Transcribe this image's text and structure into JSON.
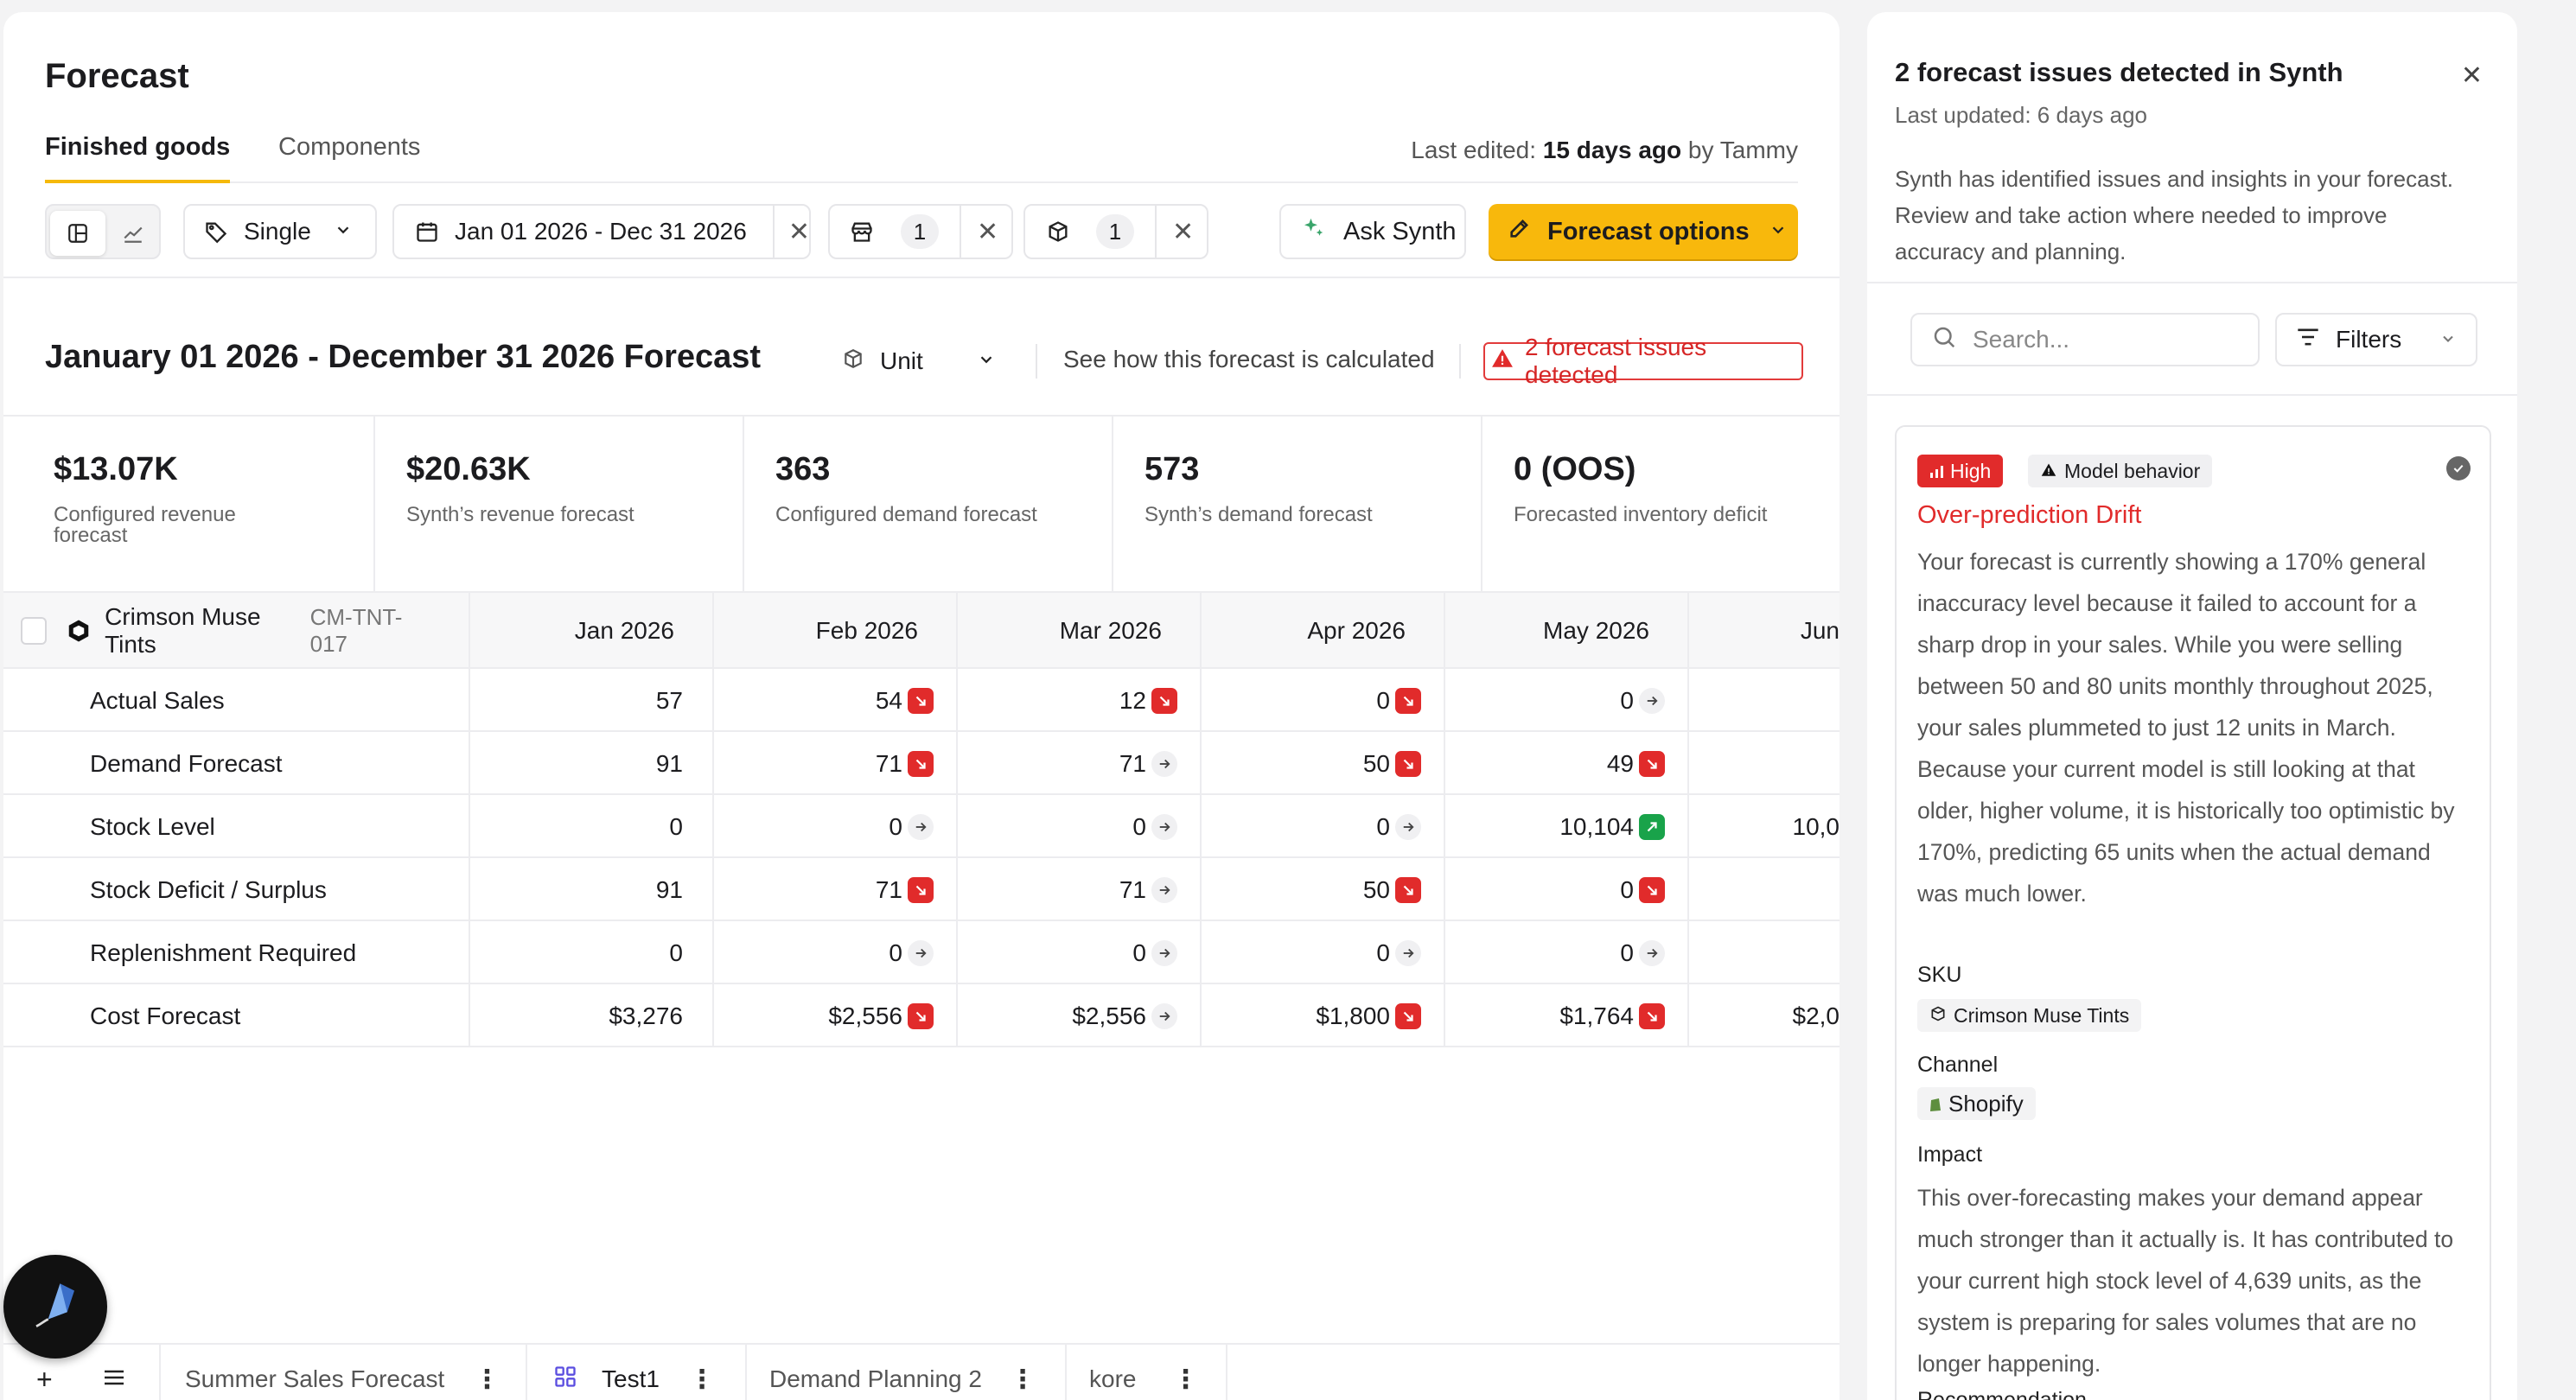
{
  "page": {
    "title": "Forecast",
    "tabs": [
      "Finished goods",
      "Components"
    ],
    "last_edited_label": "Last edited:",
    "last_edited_value": "15 days ago",
    "last_edited_by": "by Tammy"
  },
  "toolbar": {
    "mode": "Single",
    "date_range": "Jan 01 2026 - Dec 31 2026",
    "location_count": "1",
    "product_count": "1",
    "ask_label": "Ask Synth",
    "options_label": "Forecast options"
  },
  "forecast_header": {
    "title": "January 01 2026 - December 31 2026 Forecast",
    "unit": "Unit",
    "see_calc": "See how this forecast is calculated",
    "issues_link": "2 forecast issues detected"
  },
  "metrics": [
    {
      "value": "$13.07K",
      "label": "Configured revenue forecast"
    },
    {
      "value": "$20.63K",
      "label": "Synth’s revenue forecast"
    },
    {
      "value": "363",
      "label": "Configured demand forecast"
    },
    {
      "value": "573",
      "label": "Synth’s demand forecast"
    },
    {
      "value": "0 (OOS)",
      "label": "Forecasted inventory deficit"
    }
  ],
  "table": {
    "product_name": "Crimson Muse Tints",
    "product_sku": "CM-TNT-017",
    "months": [
      "Jan 2026",
      "Feb 2026",
      "Mar 2026",
      "Apr 2026",
      "May 2026",
      "Jun"
    ],
    "rows": [
      {
        "label": "Actual Sales",
        "cells": [
          {
            "v": "57",
            "t": ""
          },
          {
            "v": "54",
            "t": "down"
          },
          {
            "v": "12",
            "t": "down"
          },
          {
            "v": "0",
            "t": "down"
          },
          {
            "v": "0",
            "t": "flat"
          },
          {
            "v": "",
            "t": ""
          }
        ]
      },
      {
        "label": "Demand Forecast",
        "cells": [
          {
            "v": "91",
            "t": ""
          },
          {
            "v": "71",
            "t": "down"
          },
          {
            "v": "71",
            "t": "flat"
          },
          {
            "v": "50",
            "t": "down"
          },
          {
            "v": "49",
            "t": "down"
          },
          {
            "v": "",
            "t": ""
          }
        ]
      },
      {
        "label": "Stock Level",
        "cells": [
          {
            "v": "0",
            "t": ""
          },
          {
            "v": "0",
            "t": "flat"
          },
          {
            "v": "0",
            "t": "flat"
          },
          {
            "v": "0",
            "t": "flat"
          },
          {
            "v": "10,104",
            "t": "up"
          },
          {
            "v": "10,0",
            "t": ""
          }
        ]
      },
      {
        "label": "Stock Deficit / Surplus",
        "cells": [
          {
            "v": "91",
            "t": ""
          },
          {
            "v": "71",
            "t": "down"
          },
          {
            "v": "71",
            "t": "flat"
          },
          {
            "v": "50",
            "t": "down"
          },
          {
            "v": "0",
            "t": "down"
          },
          {
            "v": "",
            "t": ""
          }
        ]
      },
      {
        "label": "Replenishment Required",
        "cells": [
          {
            "v": "0",
            "t": ""
          },
          {
            "v": "0",
            "t": "flat"
          },
          {
            "v": "0",
            "t": "flat"
          },
          {
            "v": "0",
            "t": "flat"
          },
          {
            "v": "0",
            "t": "flat"
          },
          {
            "v": "",
            "t": ""
          }
        ]
      },
      {
        "label": "Cost Forecast",
        "cells": [
          {
            "v": "$3,276",
            "t": ""
          },
          {
            "v": "$2,556",
            "t": "down"
          },
          {
            "v": "$2,556",
            "t": "flat"
          },
          {
            "v": "$1,800",
            "t": "down"
          },
          {
            "v": "$1,764",
            "t": "down"
          },
          {
            "v": "$2,0",
            "t": ""
          }
        ]
      }
    ]
  },
  "bottom_tabs": [
    "Summer Sales Forecast",
    "Test1",
    "Demand Planning 2",
    "kore"
  ],
  "side": {
    "title": "2 forecast issues detected in Synth",
    "updated": "Last updated: 6 days ago",
    "description": "Synth has identified issues and insights in your forecast. Review and take action where needed to improve accuracy and planning.",
    "search_placeholder": "Search...",
    "filters_label": "Filters",
    "issue": {
      "severity": "High",
      "category": "Model behavior",
      "title": "Over-prediction Drift",
      "body": "Your forecast is currently showing a 170% general inaccuracy level because it failed to account for a sharp drop in your sales. While you were selling between 50 and 80 units monthly throughout 2025, your sales plummeted to just 12 units in March. Because your current model is still looking at that older, higher volume, it is historically too optimistic by 170%, predicting 65 units when the actual demand was much lower.",
      "sku_label": "SKU",
      "sku_value": "Crimson Muse Tints",
      "channel_label": "Channel",
      "channel_value": "Shopify",
      "impact_label": "Impact",
      "impact_body": "This over-forecasting makes your demand appear much stronger than it actually is. It has contributed to your current high stock level of 4,639 units, as the system is preparing for sales volumes that are no longer happening.",
      "recommendation_label": "Recommendation"
    }
  },
  "colors": {
    "accent": "#f8b80c",
    "danger": "#e12b2b",
    "success": "#19a34a"
  }
}
